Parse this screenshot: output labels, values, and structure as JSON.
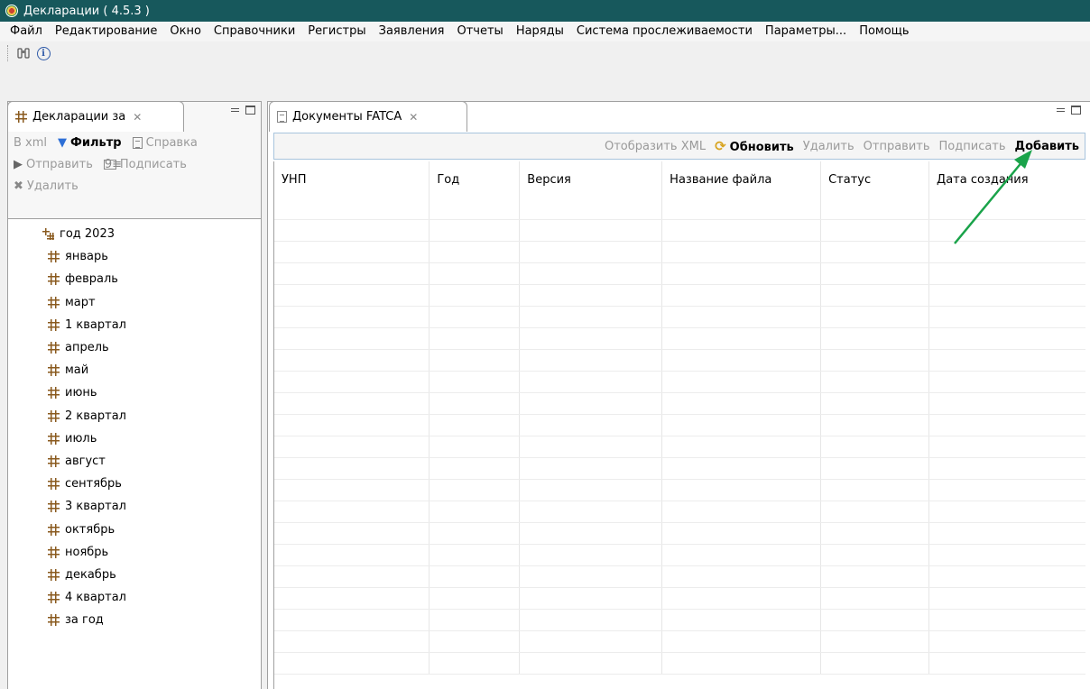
{
  "window": {
    "title": "Декларации ( 4.5.3 )"
  },
  "menu": [
    "Файл",
    "Редактирование",
    "Окно",
    "Справочники",
    "Регистры",
    "Заявления",
    "Отчеты",
    "Наряды",
    "Система прослеживаемости",
    "Параметры...",
    "Помощь"
  ],
  "toolbar": {
    "icons": [
      "binoculars-icon",
      "info-icon"
    ],
    "info_glyph": "i"
  },
  "left_panel": {
    "tab_title": "Декларации за",
    "tools_row1": {
      "xml": "В xml",
      "filter": "Фильтр",
      "help": "Справка"
    },
    "tools_row2": {
      "send": "Отправить",
      "sign": "Подписать",
      "sign_glyph": "9≡"
    },
    "tools_row3": {
      "delete": "Удалить"
    },
    "tree": {
      "root": "год 2023",
      "items": [
        "январь",
        "февраль",
        "март",
        "1 квартал",
        "апрель",
        "май",
        "июнь",
        "2 квартал",
        "июль",
        "август",
        "сентябрь",
        "3 квартал",
        "октябрь",
        "ноябрь",
        "декабрь",
        "4 квартал",
        "за год"
      ]
    }
  },
  "right_panel": {
    "tab_title": "Документы FATCA",
    "tools": {
      "show_xml": "Отобразить XML",
      "refresh": "Обновить",
      "delete": "Удалить",
      "send": "Отправить",
      "sign": "Подписать",
      "add": "Добавить"
    },
    "table": {
      "columns": [
        "УНП",
        "Год",
        "Версия",
        "Название файла",
        "Статус",
        "Дата создания"
      ],
      "rows": []
    }
  },
  "colors": {
    "titlebar": "#17585c",
    "arrow": "#1aa34a",
    "tree_icon": "#8a5a1e"
  }
}
